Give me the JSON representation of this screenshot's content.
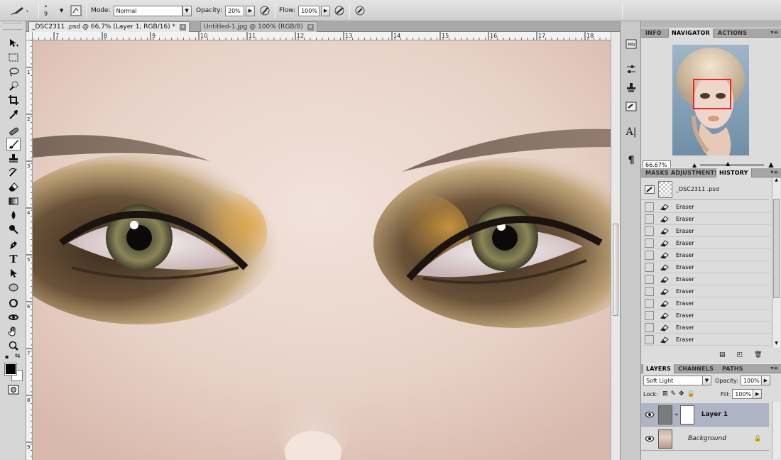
{
  "options_bar": {
    "brush_size": "9",
    "mode_label": "Mode:",
    "mode_value": "Normal",
    "opacity_label": "Opacity:",
    "opacity_value": "20%",
    "flow_label": "Flow:",
    "flow_value": "100%"
  },
  "tabs": [
    {
      "label": "_DSC2311 .psd @ 66,7% (Layer 1, RGB/16) *",
      "active": true
    },
    {
      "label": "Untitled-1.jpg @ 100% (RGB/8)",
      "active": false
    }
  ],
  "rulers": {
    "horizontal": [
      "7",
      "8",
      "9",
      "10",
      "11",
      "12",
      "13",
      "14",
      "15",
      "16",
      "17",
      "18"
    ],
    "vertical": [
      "1",
      "2",
      "3",
      "4",
      "5",
      "6",
      "7",
      "8",
      "9"
    ]
  },
  "navigator_group": {
    "tabs": [
      "INFO",
      "NAVIGATOR",
      "ACTIONS"
    ],
    "active_tab": "NAVIGATOR",
    "zoom": "66.67%"
  },
  "history_group": {
    "tabs": [
      "MASKS",
      "ADJUSTMENTS",
      "HISTORY"
    ],
    "active_tab": "HISTORY",
    "snapshot": "_DSC2311 .psd",
    "states": [
      "Eraser",
      "Eraser",
      "Eraser",
      "Eraser",
      "Eraser",
      "Eraser",
      "Eraser",
      "Eraser",
      "Eraser",
      "Eraser",
      "Eraser",
      "Eraser"
    ]
  },
  "layers_group": {
    "tabs": [
      "LAYERS",
      "CHANNELS",
      "PATHS"
    ],
    "active_tab": "LAYERS",
    "blend_mode": "Soft Light",
    "opacity_label": "Opacity:",
    "opacity_value": "100%",
    "lock_label": "Lock:",
    "fill_label": "Fill:",
    "fill_value": "100%",
    "layers": [
      {
        "name": "Layer 1",
        "selected": true
      },
      {
        "name": "Background",
        "selected": false,
        "locked": true
      }
    ]
  },
  "colors": {
    "foreground": "#000000",
    "background": "#ffffff",
    "navigator_box": "#ff1f1f",
    "selected_layer": "#aeb3c6"
  }
}
